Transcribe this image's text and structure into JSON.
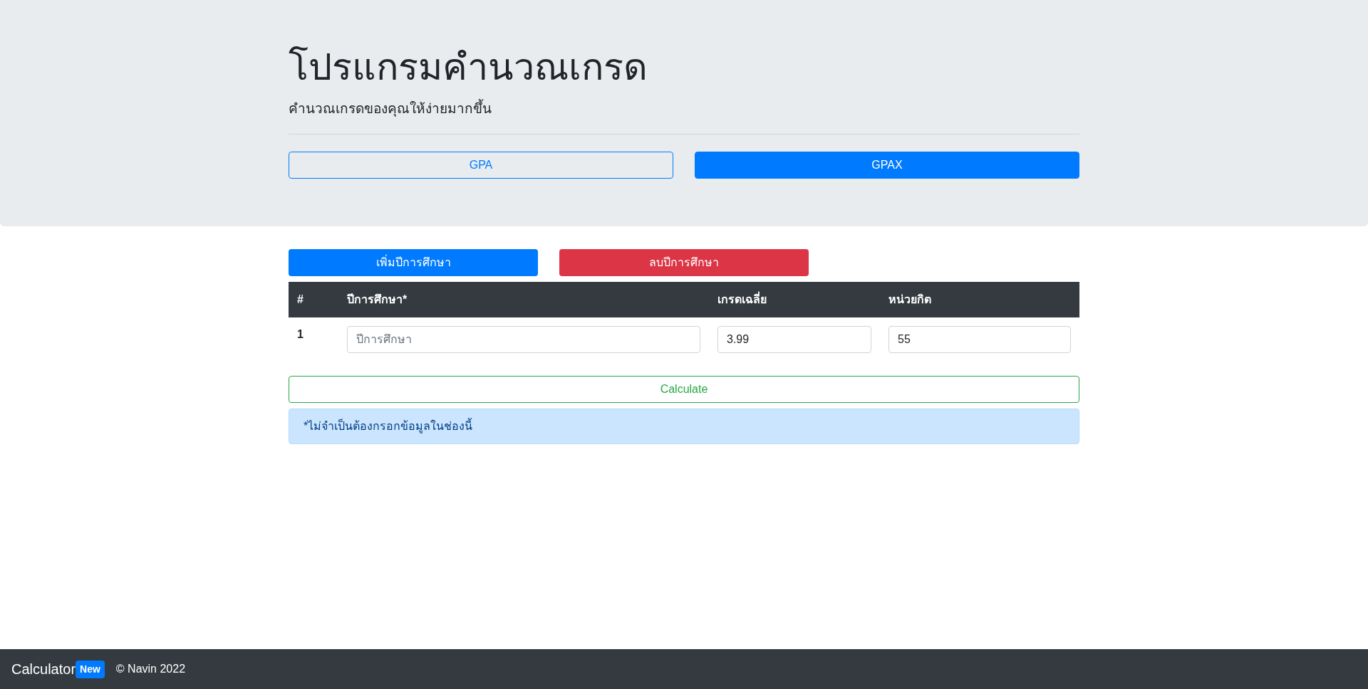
{
  "header": {
    "title": "โปรแกรมคำนวณเกรด",
    "subtitle": "คำนวณเกรดของคุณให้ง่ายมากขึ้น"
  },
  "modes": [
    {
      "label": "GPA",
      "selected": false
    },
    {
      "label": "GPAX",
      "selected": true
    }
  ],
  "actions": [
    {
      "label": "เพิ่มปีการศึกษา",
      "kind": "add"
    },
    {
      "label": "ลบปีการศึกษา",
      "kind": "remove"
    }
  ],
  "table": {
    "columns": [
      "#",
      "ปีการศึกษา*",
      "เกรดเฉลี่ย",
      "หน่วยกิต"
    ],
    "rows": [
      {
        "number": "1",
        "year": {
          "placeholder": "ปีการศึกษา"
        },
        "grade": {
          "value": "3.99"
        },
        "credits": {
          "value": "55"
        }
      }
    ]
  },
  "calculate_button": "Calculate",
  "note": "*ไม่จำเป็นต้องกรอกข้อมูลในช่องนี้",
  "footer": {
    "brand": "Calculator",
    "badge": "New",
    "copyright": "© Navin 2022"
  }
}
